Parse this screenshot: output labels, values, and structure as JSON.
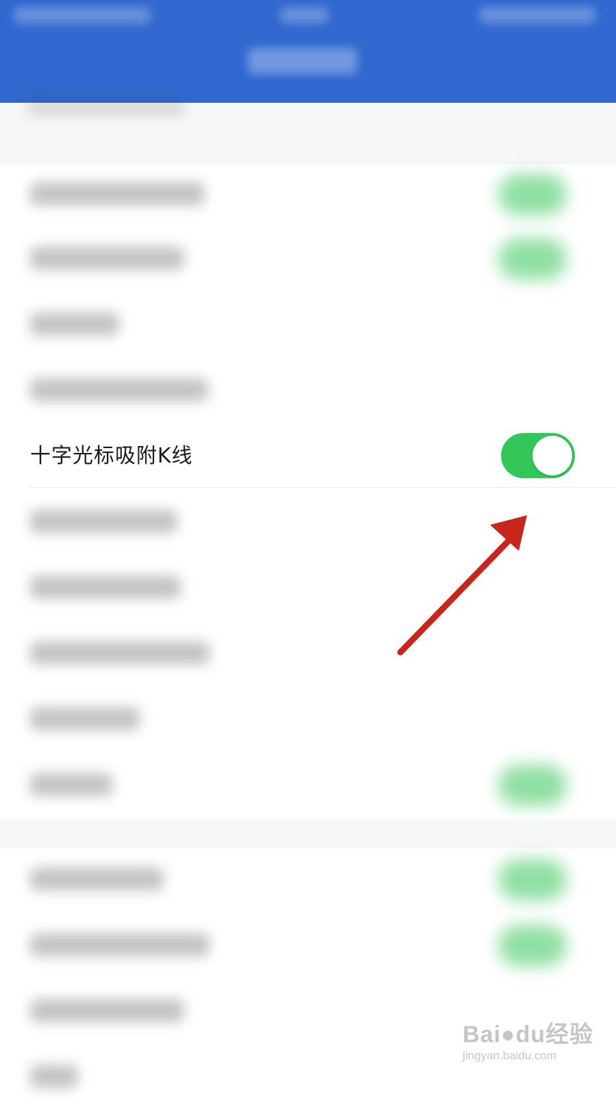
{
  "settings": {
    "highlighted_row": {
      "label": "十字光标吸附K线",
      "toggle_state": "on",
      "toggle_color": "#33c759"
    }
  },
  "annotation": {
    "arrow_color": "#c8251c",
    "arrow_target": "toggle-switch"
  },
  "watermark": {
    "brand": "Bai",
    "paw_icon": "paw-icon",
    "brand_suffix": "du经验",
    "url": "jingyan.baidu.com"
  },
  "colors": {
    "header": "#3068cf",
    "background": "#ffffff"
  }
}
